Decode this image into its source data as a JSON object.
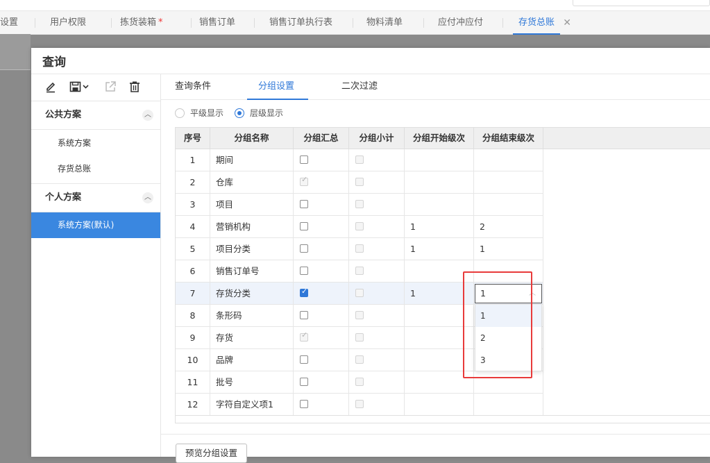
{
  "tabs": [
    {
      "label": "设置",
      "active": false,
      "modified": false
    },
    {
      "label": "用户权限",
      "active": false,
      "modified": false
    },
    {
      "label": "拣货装箱",
      "active": false,
      "modified": true
    },
    {
      "label": "销售订单",
      "active": false,
      "modified": false
    },
    {
      "label": "销售订单执行表",
      "active": false,
      "modified": false
    },
    {
      "label": "物料清单",
      "active": false,
      "modified": false
    },
    {
      "label": "应付冲应付",
      "active": false,
      "modified": false
    },
    {
      "label": "存货总账",
      "active": true,
      "modified": false
    }
  ],
  "modified_marker": "*",
  "close_glyph": "✕",
  "dialog": {
    "title": "查询",
    "toolbar_icons": [
      "edit-icon",
      "save-icon",
      "export-icon",
      "delete-icon"
    ],
    "public_group": {
      "label": "公共方案",
      "items": [
        "系统方案",
        "存货总账"
      ]
    },
    "personal_group": {
      "label": "个人方案",
      "items": [
        "系统方案(默认)"
      ]
    },
    "query_tabs": [
      {
        "label": "查询条件",
        "active": false
      },
      {
        "label": "分组设置",
        "active": true
      },
      {
        "label": "二次过滤",
        "active": false
      }
    ],
    "display_mode": {
      "options": [
        "平级显示",
        "层级显示"
      ],
      "selected": "层级显示"
    },
    "grid": {
      "columns": [
        "序号",
        "分组名称",
        "分组汇总",
        "分组小计",
        "分组开始级次",
        "分组结束级次"
      ],
      "rows": [
        {
          "idx": "1",
          "name": "期间",
          "summary": "unchecked",
          "subtotal": "disabled",
          "start": "",
          "end": ""
        },
        {
          "idx": "2",
          "name": "仓库",
          "summary": "checked-disabled",
          "subtotal": "disabled",
          "start": "",
          "end": ""
        },
        {
          "idx": "3",
          "name": "项目",
          "summary": "unchecked",
          "subtotal": "disabled",
          "start": "",
          "end": ""
        },
        {
          "idx": "4",
          "name": "营销机构",
          "summary": "unchecked",
          "subtotal": "disabled",
          "start": "1",
          "end": "2"
        },
        {
          "idx": "5",
          "name": "项目分类",
          "summary": "unchecked",
          "subtotal": "disabled",
          "start": "1",
          "end": "1"
        },
        {
          "idx": "6",
          "name": "销售订单号",
          "summary": "unchecked",
          "subtotal": "disabled",
          "start": "",
          "end": ""
        },
        {
          "idx": "7",
          "name": "存货分类",
          "summary": "checked",
          "subtotal": "disabled",
          "start": "1",
          "end": "1"
        },
        {
          "idx": "8",
          "name": "条形码",
          "summary": "unchecked",
          "subtotal": "disabled",
          "start": "",
          "end": ""
        },
        {
          "idx": "9",
          "name": "存货",
          "summary": "checked-disabled",
          "subtotal": "disabled",
          "start": "",
          "end": ""
        },
        {
          "idx": "10",
          "name": "品牌",
          "summary": "unchecked",
          "subtotal": "disabled",
          "start": "",
          "end": ""
        },
        {
          "idx": "11",
          "name": "批号",
          "summary": "unchecked",
          "subtotal": "disabled",
          "start": "",
          "end": ""
        },
        {
          "idx": "12",
          "name": "字符自定义项1",
          "summary": "unchecked",
          "subtotal": "disabled",
          "start": "",
          "end": ""
        }
      ]
    },
    "end_level_dropdown": {
      "value": "1",
      "options": [
        "1",
        "2",
        "3"
      ],
      "highlighted": "1"
    },
    "preview_button": "预览分组设置"
  },
  "colors": {
    "accent": "#2f78d8",
    "highlight_box": "#e83a3a",
    "selected_scheme_bg": "#3a87e0"
  }
}
